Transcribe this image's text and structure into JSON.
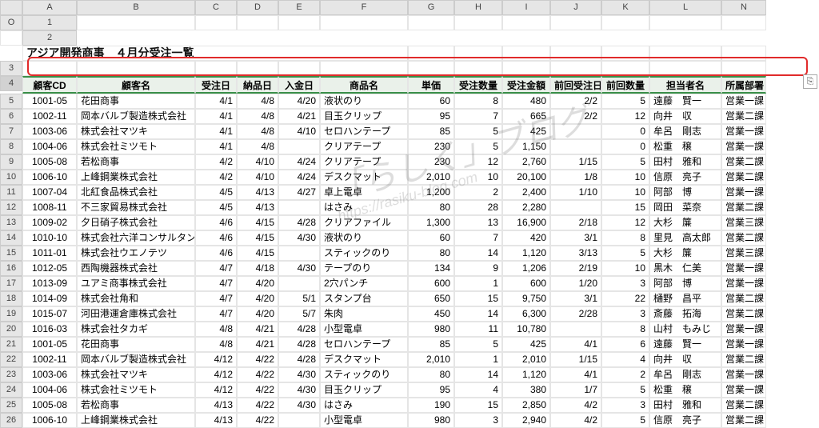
{
  "cols": [
    "A",
    "B",
    "C",
    "D",
    "E",
    "F",
    "G",
    "H",
    "I",
    "J",
    "K",
    "L",
    "N",
    "O"
  ],
  "title": "アジア開発商事　４月分受注一覧",
  "headers": [
    "顧客CD",
    "顧客名",
    "受注日",
    "納品日",
    "入金日",
    "商品名",
    "単価",
    "受注数量",
    "受注金額",
    "前回受注日",
    "前回数量",
    "担当者名",
    "所属部署"
  ],
  "rows": [
    {
      "n": 5,
      "d": [
        "1001-05",
        "花田商事",
        "4/1",
        "4/8",
        "4/20",
        "液状のり",
        "60",
        "8",
        "480",
        "2/2",
        "5",
        "遠藤　賢一",
        "営業一課"
      ]
    },
    {
      "n": 6,
      "d": [
        "1002-11",
        "岡本バルブ製造株式会社",
        "4/1",
        "4/8",
        "4/21",
        "目玉クリップ",
        "95",
        "7",
        "665",
        "2/2",
        "12",
        "向井　収",
        "営業二課"
      ]
    },
    {
      "n": 7,
      "d": [
        "1003-06",
        "株式会社マツキ",
        "4/1",
        "4/8",
        "4/10",
        "セロハンテープ",
        "85",
        "5",
        "425",
        "",
        "0",
        "牟呂　剛志",
        "営業一課"
      ]
    },
    {
      "n": 8,
      "d": [
        "1004-06",
        "株式会社ミツモト",
        "4/1",
        "4/8",
        "",
        "クリアテープ",
        "230",
        "5",
        "1,150",
        "",
        "0",
        "松重　穣",
        "営業一課"
      ]
    },
    {
      "n": 9,
      "d": [
        "1005-08",
        "若松商事",
        "4/2",
        "4/10",
        "4/24",
        "クリアテープ",
        "230",
        "12",
        "2,760",
        "1/15",
        "5",
        "田村　雅和",
        "営業二課"
      ]
    },
    {
      "n": 10,
      "d": [
        "1006-10",
        "上峰鋼業株式会社",
        "4/2",
        "4/10",
        "4/24",
        "デスクマット",
        "2,010",
        "10",
        "20,100",
        "1/8",
        "10",
        "信原　亮子",
        "営業二課"
      ]
    },
    {
      "n": 11,
      "d": [
        "1007-04",
        "北紅食品株式会社",
        "4/5",
        "4/13",
        "4/27",
        "卓上電卓",
        "1,200",
        "2",
        "2,400",
        "1/10",
        "10",
        "阿部　博",
        "営業一課"
      ]
    },
    {
      "n": 12,
      "d": [
        "1008-11",
        "不三家貿易株式会社",
        "4/5",
        "4/13",
        "",
        "はさみ",
        "80",
        "28",
        "2,280",
        "",
        "15",
        "岡田　菜奈",
        "営業二課"
      ]
    },
    {
      "n": 13,
      "d": [
        "1009-02",
        "夕日硝子株式会社",
        "4/6",
        "4/15",
        "4/28",
        "クリアファイル",
        "1,300",
        "13",
        "16,900",
        "2/18",
        "12",
        "大杉　簾",
        "営業三課"
      ]
    },
    {
      "n": 14,
      "d": [
        "1010-10",
        "株式会社六洋コンサルタント",
        "4/6",
        "4/15",
        "4/30",
        "液状のり",
        "60",
        "7",
        "420",
        "3/1",
        "8",
        "里見　高太郎",
        "営業二課"
      ]
    },
    {
      "n": 15,
      "d": [
        "1011-01",
        "株式会社ウエノテツ",
        "4/6",
        "4/15",
        "",
        "スティックのり",
        "80",
        "14",
        "1,120",
        "3/13",
        "5",
        "大杉　簾",
        "営業三課"
      ]
    },
    {
      "n": 16,
      "d": [
        "1012-05",
        "西陶機器株式会社",
        "4/7",
        "4/18",
        "4/30",
        "テープのり",
        "134",
        "9",
        "1,206",
        "2/19",
        "10",
        "黒木　仁美",
        "営業一課"
      ]
    },
    {
      "n": 17,
      "d": [
        "1013-09",
        "ユアミ商事株式会社",
        "4/7",
        "4/20",
        "",
        "2穴パンチ",
        "600",
        "1",
        "600",
        "1/20",
        "3",
        "阿部　博",
        "営業一課"
      ]
    },
    {
      "n": 18,
      "d": [
        "1014-09",
        "株式会社角和",
        "4/7",
        "4/20",
        "5/1",
        "スタンプ台",
        "650",
        "15",
        "9,750",
        "3/1",
        "22",
        "樋野　昌平",
        "営業二課"
      ]
    },
    {
      "n": 19,
      "d": [
        "1015-07",
        "河田港運倉庫株式会社",
        "4/7",
        "4/20",
        "5/7",
        "朱肉",
        "450",
        "14",
        "6,300",
        "2/28",
        "3",
        "斎藤　拓海",
        "営業二課"
      ]
    },
    {
      "n": 20,
      "d": [
        "1016-03",
        "株式会社タカギ",
        "4/8",
        "4/21",
        "4/28",
        "小型電卓",
        "980",
        "11",
        "10,780",
        "",
        "8",
        "山村　もみじ",
        "営業一課"
      ]
    },
    {
      "n": 21,
      "d": [
        "1001-05",
        "花田商事",
        "4/8",
        "4/21",
        "4/28",
        "セロハンテープ",
        "85",
        "5",
        "425",
        "4/1",
        "6",
        "遠藤　賢一",
        "営業一課"
      ]
    },
    {
      "n": 22,
      "d": [
        "1002-11",
        "岡本バルブ製造株式会社",
        "4/12",
        "4/22",
        "4/28",
        "デスクマット",
        "2,010",
        "1",
        "2,010",
        "1/15",
        "4",
        "向井　収",
        "営業二課"
      ]
    },
    {
      "n": 23,
      "d": [
        "1003-06",
        "株式会社マツキ",
        "4/12",
        "4/22",
        "4/30",
        "スティックのり",
        "80",
        "14",
        "1,120",
        "4/1",
        "2",
        "牟呂　剛志",
        "営業一課"
      ]
    },
    {
      "n": 24,
      "d": [
        "1004-06",
        "株式会社ミツモト",
        "4/12",
        "4/22",
        "4/30",
        "目玉クリップ",
        "95",
        "4",
        "380",
        "1/7",
        "5",
        "松重　穣",
        "営業一課"
      ]
    },
    {
      "n": 25,
      "d": [
        "1005-08",
        "若松商事",
        "4/13",
        "4/22",
        "4/30",
        "はさみ",
        "190",
        "15",
        "2,850",
        "4/2",
        "3",
        "田村　雅和",
        "営業二課"
      ]
    },
    {
      "n": 26,
      "d": [
        "1006-10",
        "上峰鋼業株式会社",
        "4/13",
        "4/22",
        "",
        "小型電卓",
        "980",
        "3",
        "2,940",
        "4/2",
        "5",
        "信原　亮子",
        "営業二課"
      ]
    }
  ],
  "watermark": {
    "main": "「らしく」ブログ",
    "sub": "https://rasiku-blog.com"
  },
  "numericCols": [
    2,
    3,
    4,
    6,
    7,
    8,
    9,
    10
  ]
}
